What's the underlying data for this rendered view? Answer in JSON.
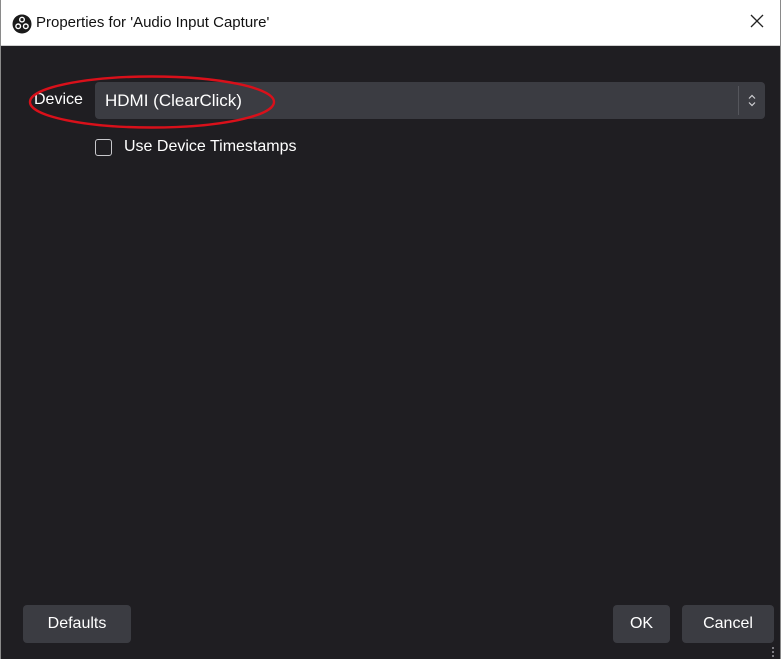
{
  "window": {
    "title": "Properties for 'Audio Input Capture'",
    "app_icon": "obs-logo-icon",
    "close_icon": "close-icon"
  },
  "form": {
    "device_label": "Device",
    "device_value": "HDMI (ClearClick)",
    "device_select_icon": "up-down-arrows-icon",
    "timestamps_label": "Use Device Timestamps",
    "timestamps_checked": false
  },
  "annotation": {
    "shape": "ellipse",
    "color": "#d9101a",
    "target": "device-field"
  },
  "buttons": {
    "defaults": "Defaults",
    "ok": "OK",
    "cancel": "Cancel"
  },
  "colors": {
    "background": "#1f1e22",
    "control": "#3b3c42",
    "titlebar": "#ffffff",
    "text": "#ffffff"
  }
}
